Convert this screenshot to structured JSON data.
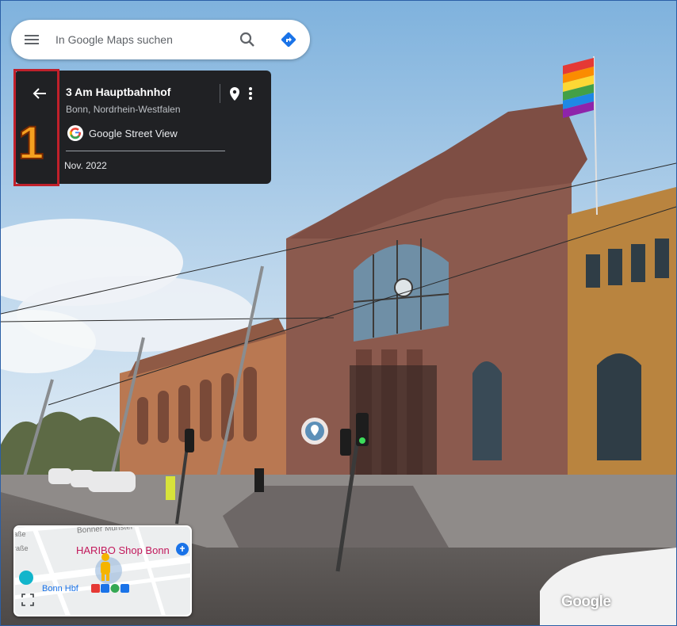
{
  "search": {
    "placeholder": "In Google Maps suchen",
    "menu_icon": "hamburger-menu-icon",
    "search_icon": "magnifier-icon",
    "directions_icon": "directions-diamond-icon",
    "directions_color": "#1a73e8"
  },
  "location_card": {
    "title": "3 Am Hauptbahnhof",
    "subtitle": "Bonn, Nordrhein-Westfalen",
    "source": "Google Street View",
    "date": "Nov. 2022",
    "back_icon": "arrow-left-icon",
    "pin_icon": "location-pin-icon",
    "more_icon": "more-vertical-icon",
    "background": "#202124"
  },
  "annotation": {
    "step_number": "1",
    "highlight_color": "#c0202b",
    "number_color": "#f5a020"
  },
  "minimap": {
    "poi_label": "HARIBO Shop Bonn",
    "station_label": "Bonn Hbf",
    "street_label": "Bonner Münster",
    "street_fragment_1": "aße",
    "street_fragment_2": "raße",
    "expand_icon": "expand-corners-icon",
    "pegman_icon": "pegman-icon"
  },
  "panorama": {
    "scene": "Bonn Hauptbahnhof station building, street level",
    "waypoint_icon": "street-view-waypoint-icon"
  },
  "watermark": "Google"
}
